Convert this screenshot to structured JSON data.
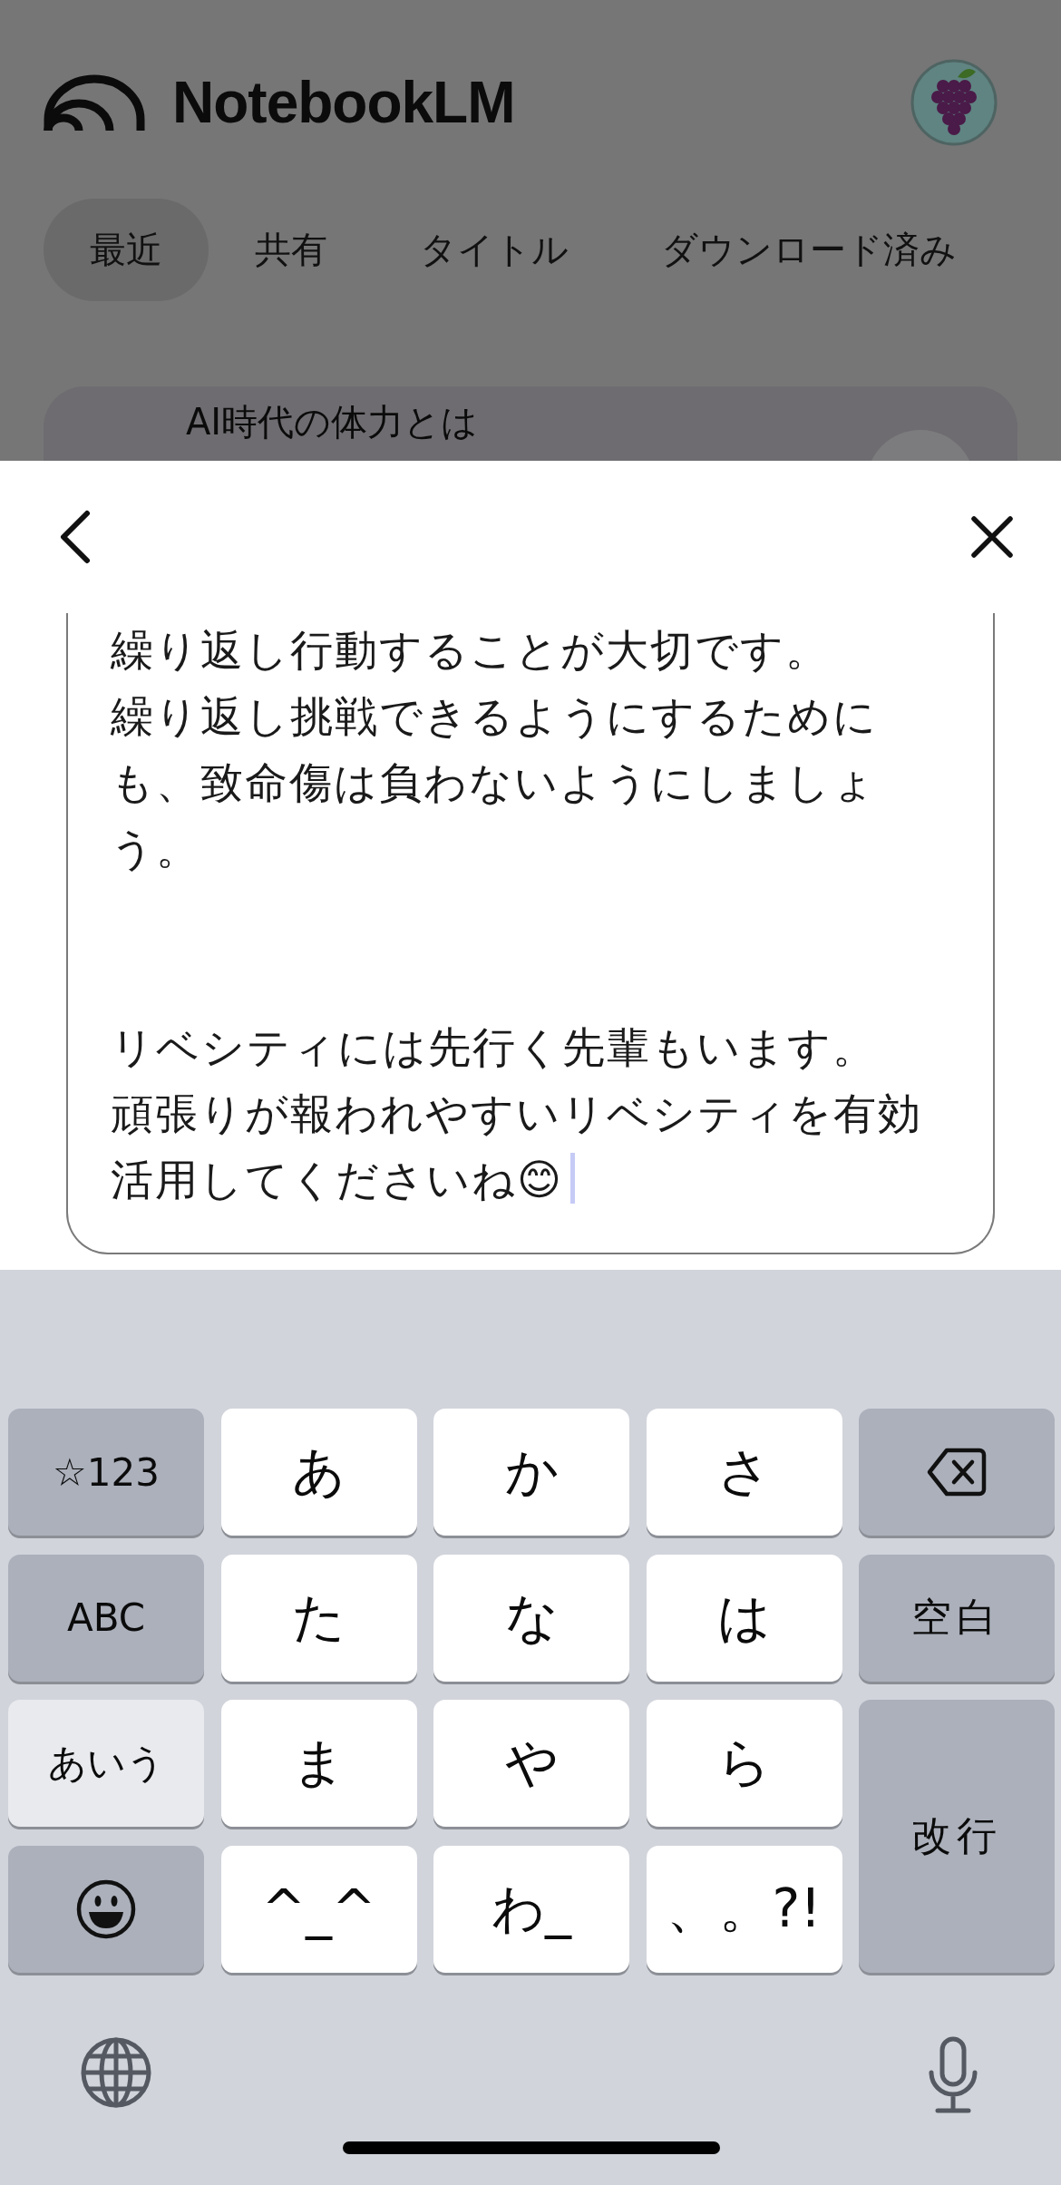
{
  "header": {
    "title": "NotebookLM"
  },
  "tabs": [
    {
      "label": "最近",
      "selected": true
    },
    {
      "label": "共有",
      "selected": false
    },
    {
      "label": "タイトル",
      "selected": false
    },
    {
      "label": "ダウンロード済み",
      "selected": false
    }
  ],
  "notebook_card": {
    "title": "AI時代の体力とは"
  },
  "editor": {
    "blocks": [
      [
        "繰り返し行動することが大切です。",
        "繰り返し挑戦できるようにするためにも、致命傷は負わないようにしましょう。"
      ],
      [
        "リベシティには先行く先輩もいます。",
        "頑張りが報われやすいリベシティを有効活用してくださいね😊"
      ]
    ]
  },
  "keyboard": {
    "keys": [
      {
        "kind": "mode",
        "label": "☆123",
        "selected": false
      },
      {
        "kind": "char",
        "label": "あ"
      },
      {
        "kind": "char",
        "label": "か"
      },
      {
        "kind": "char",
        "label": "さ"
      },
      {
        "kind": "backspace"
      },
      {
        "kind": "mode",
        "label": "ABC",
        "selected": false
      },
      {
        "kind": "char",
        "label": "た"
      },
      {
        "kind": "char",
        "label": "な"
      },
      {
        "kind": "char",
        "label": "は"
      },
      {
        "kind": "action",
        "label": "空白"
      },
      {
        "kind": "mode",
        "label": "あいう",
        "selected": true
      },
      {
        "kind": "char",
        "label": "ま"
      },
      {
        "kind": "char",
        "label": "や"
      },
      {
        "kind": "char",
        "label": "ら"
      },
      {
        "kind": "enter",
        "label": "改行"
      },
      {
        "kind": "emoji"
      },
      {
        "kind": "char",
        "label": "^_^"
      },
      {
        "kind": "char",
        "label": "わ_"
      },
      {
        "kind": "char",
        "label": "、。?!"
      }
    ]
  }
}
